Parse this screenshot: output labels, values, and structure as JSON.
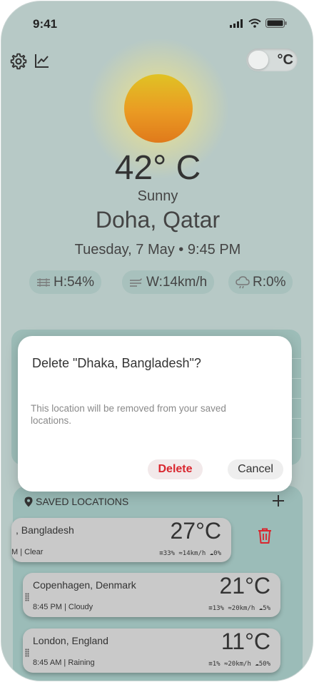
{
  "status": {
    "time": "9:41"
  },
  "header": {
    "unit_label": "°C"
  },
  "weather": {
    "temperature": "42° C",
    "condition": "Sunny",
    "city": "Doha, Qatar",
    "datetime": "Tuesday, 7 May • 9:45 PM",
    "humidity": "H:54%",
    "wind": "W:14km/h",
    "rain": "R:0%"
  },
  "dialog": {
    "title": "Delete \"Dhaka, Bangladesh\"?",
    "body": "This location will be removed from your saved locations.",
    "delete_label": "Delete",
    "cancel_label": "Cancel"
  },
  "saved": {
    "header": "SAVED LOCATIONS",
    "items": [
      {
        "name": ", Bangladesh",
        "temp": "27°C",
        "sub": "M | Clear",
        "humidity": "33%",
        "wind": "14km/h",
        "rain": "0%"
      },
      {
        "name": "Copenhagen, Denmark",
        "temp": "21°C",
        "sub": "8:45 PM | Cloudy",
        "humidity": "13%",
        "wind": "20km/h",
        "rain": "5%"
      },
      {
        "name": "London, England",
        "temp": "11°C",
        "sub": "8:45 AM | Raining",
        "humidity": "1%",
        "wind": "20km/h",
        "rain": "50%"
      }
    ]
  },
  "colors": {
    "accent_delete": "#d9262e",
    "panel": "#9bbcb8",
    "background": "#b7c9c6"
  }
}
